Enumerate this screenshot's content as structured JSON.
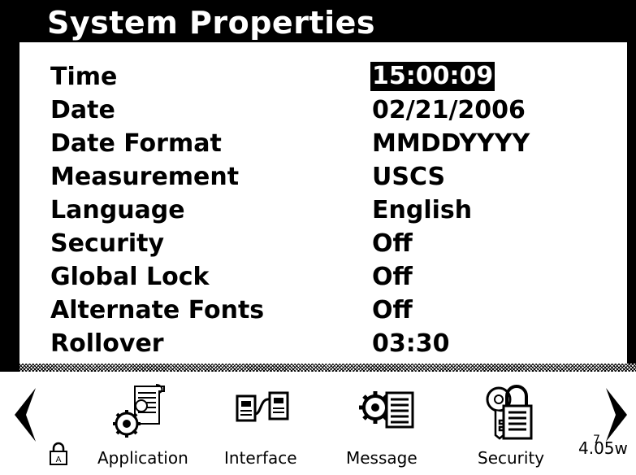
{
  "window": {
    "title": "System Properties"
  },
  "properties": [
    {
      "label": "Time",
      "value": "15:00:09",
      "selected": true
    },
    {
      "label": "Date",
      "value": "02/21/2006"
    },
    {
      "label": "Date Format",
      "value": "MMDDYYYY"
    },
    {
      "label": "Measurement",
      "value": "USCS"
    },
    {
      "label": "Language",
      "value": "English"
    },
    {
      "label": "Security",
      "value": "Off"
    },
    {
      "label": "Global Lock",
      "value": "Off"
    },
    {
      "label": "Alternate Fonts",
      "value": "Off"
    },
    {
      "label": "Rollover",
      "value": "03:30"
    }
  ],
  "nav": {
    "items": [
      {
        "label": "Application",
        "icon": "application-icon"
      },
      {
        "label": "Interface",
        "icon": "interface-icon"
      },
      {
        "label": "Message",
        "icon": "message-icon"
      },
      {
        "label": "Security",
        "icon": "security-icon"
      }
    ],
    "left_arrow": "chevron-left-icon",
    "right_arrow": "chevron-right-icon"
  },
  "status": {
    "superscript": "7",
    "value": "4.05w"
  },
  "colors": {
    "background": "#000000",
    "panel": "#ffffff",
    "text": "#000000",
    "highlight": "#000000"
  }
}
